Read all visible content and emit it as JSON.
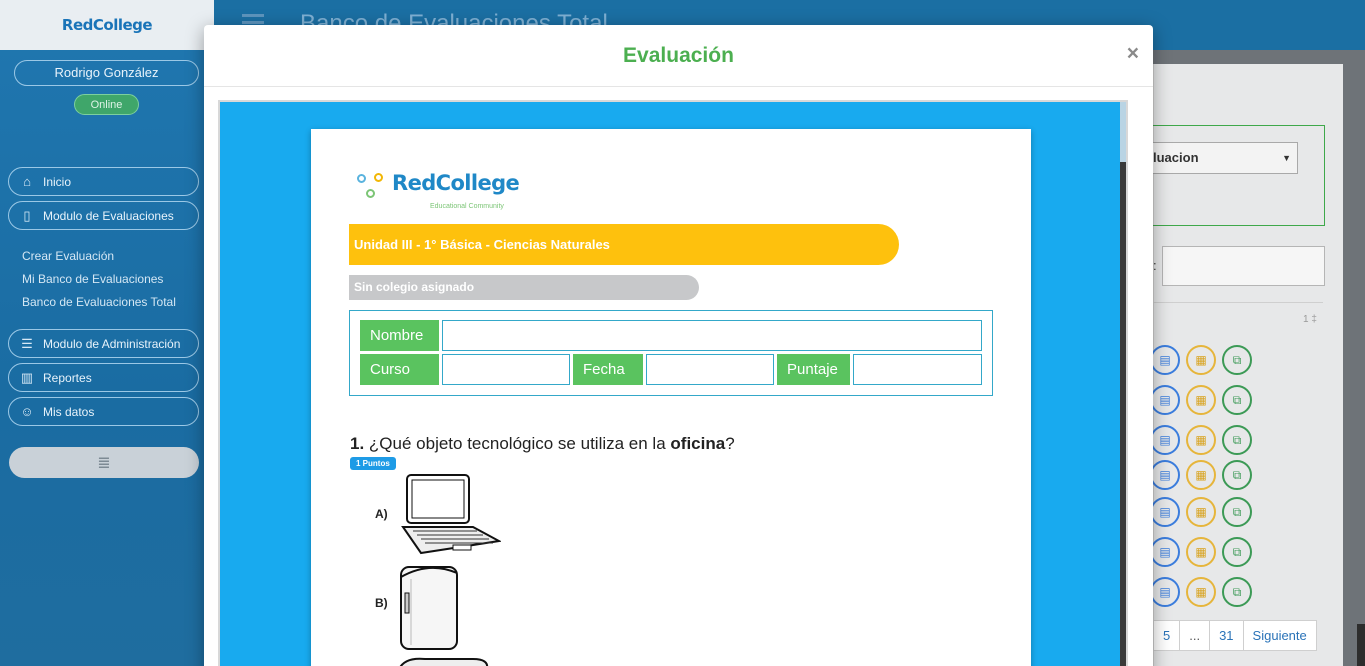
{
  "app": {
    "brand": "RedCollege",
    "user_name": "Rodrigo González",
    "status": "Online",
    "page_title": "Banco de Evaluaciones Total"
  },
  "sidebar": {
    "items": [
      {
        "label": "Inicio",
        "icon": "home-icon"
      },
      {
        "label": "Modulo de Evaluaciones",
        "icon": "file-icon"
      },
      {
        "label": "Modulo de Administración",
        "icon": "database-icon"
      },
      {
        "label": "Reportes",
        "icon": "bar-chart-icon"
      },
      {
        "label": "Mis datos",
        "icon": "users-icon"
      }
    ],
    "subitems": [
      "Crear Evaluación",
      "Mi Banco de Evaluaciones",
      "Banco de Evaluaciones Total"
    ]
  },
  "background_panel": {
    "select_value": "luacion",
    "count_text": "1 ‡",
    "pagination": [
      "5",
      "...",
      "31",
      "Siguiente"
    ]
  },
  "modal": {
    "title": "Evaluación",
    "close": "×"
  },
  "document": {
    "logo_text": "RedCollege",
    "logo_sub": "Educational Community",
    "unit_title": "Unidad III - 1° Básica - Ciencias Naturales",
    "school": "Sin colegio asignado",
    "labels": {
      "nombre": "Nombre",
      "curso": "Curso",
      "fecha": "Fecha",
      "puntaje": "Puntaje"
    },
    "question": {
      "number": "1.",
      "text_before": "¿Qué objeto tecnológico se utiliza en la",
      "bold": "oficina",
      "text_after": "?",
      "points": "1 Puntos",
      "options": [
        "A)",
        "B)"
      ]
    }
  },
  "colors": {
    "accent_green": "#4caf50",
    "band_yellow": "#fec10d",
    "viewer_blue": "#18aaef",
    "field_green": "#5ac35f"
  }
}
